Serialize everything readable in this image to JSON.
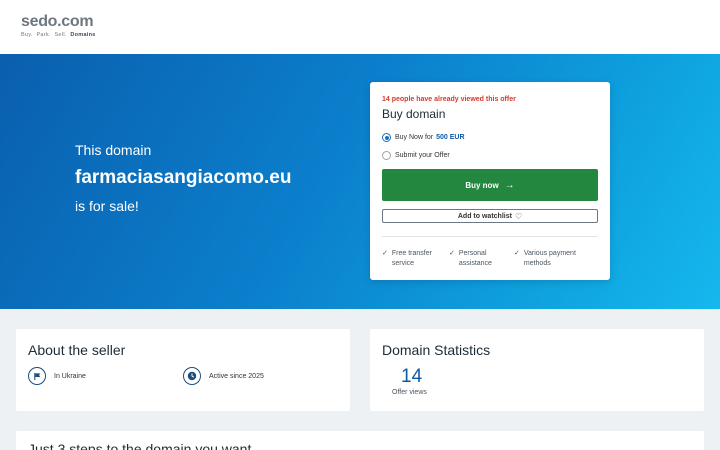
{
  "brand": {
    "name": "sedo.com",
    "tagline_parts": [
      "Buy.",
      "Park.",
      "Sell."
    ],
    "tagline_bold": "Domains"
  },
  "hero": {
    "pre": "This domain",
    "domain": "farmaciasangiacomo.eu",
    "post": "is for sale!"
  },
  "buy_card": {
    "viewed": "14 people have already viewed this offer",
    "title": "Buy domain",
    "options": [
      {
        "label": "Buy Now for",
        "price": "500 EUR",
        "selected": true
      },
      {
        "label": "Submit your Offer",
        "selected": false
      }
    ],
    "buy_label": "Buy now",
    "watchlist_label": "Add to watchlist",
    "features": [
      {
        "line1": "Free transfer",
        "line2": "service"
      },
      {
        "line1": "Personal",
        "line2": "assistance"
      },
      {
        "line1": "Various payment",
        "line2": "methods"
      }
    ]
  },
  "seller": {
    "title": "About the seller",
    "location": "In Ukraine",
    "active": "Active since 2025"
  },
  "stats": {
    "title": "Domain Statistics",
    "offer_views": "14",
    "offer_views_label": "Offer views"
  },
  "steps": {
    "title": "Just 3 steps to the domain you want"
  },
  "colors": {
    "accent": "#0e5aa7",
    "buy_button": "#23873f",
    "alert": "#d23b2f"
  }
}
